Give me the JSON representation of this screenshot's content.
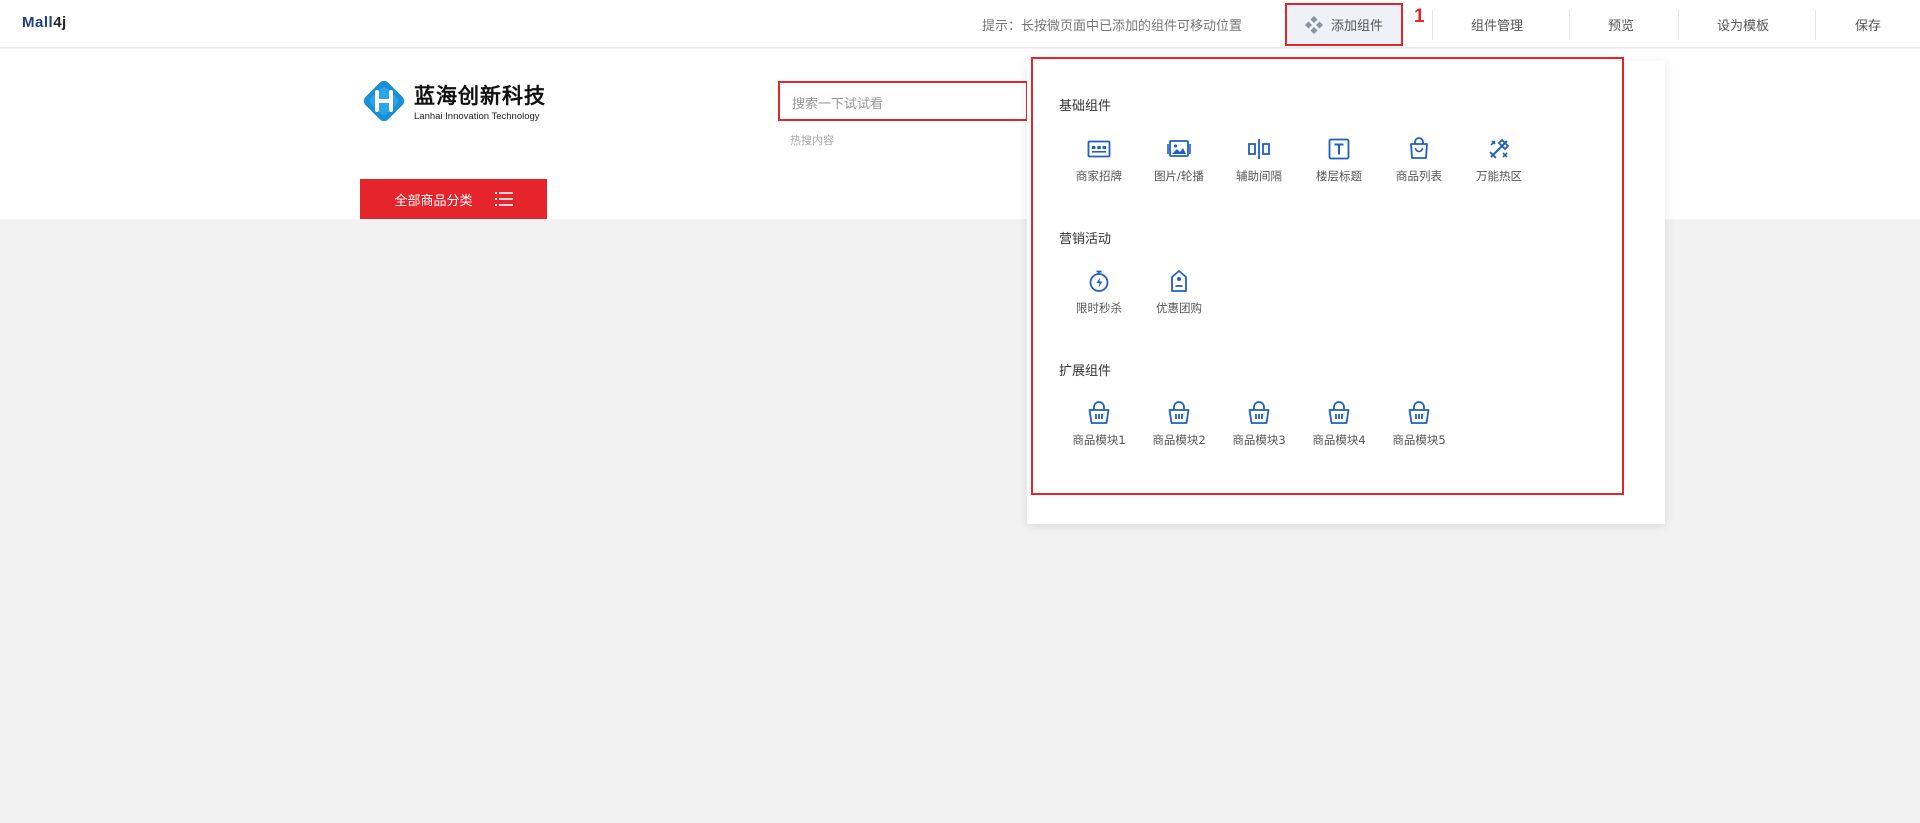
{
  "toolbar": {
    "logo": "Mall4j",
    "hint": "提示：长按微页面中已添加的组件可移动位置",
    "add_component": "添加组件",
    "annotation": "1",
    "component_manage": "组件管理",
    "preview": "预览",
    "set_template": "设为模板",
    "save": "保存"
  },
  "store": {
    "brand_name": "蓝海创新科技",
    "brand_en": "Lanhai Innovation Technology",
    "search_placeholder": "搜索一下试试看",
    "hot_search": "热搜内容",
    "all_categories": "全部商品分类"
  },
  "panel": {
    "sections": [
      {
        "title": "基础组件",
        "items": [
          {
            "label": "商家招牌",
            "icon": "store-sign-icon"
          },
          {
            "label": "图片/轮播",
            "icon": "image-carousel-icon"
          },
          {
            "label": "辅助间隔",
            "icon": "spacer-icon"
          },
          {
            "label": "楼层标题",
            "icon": "floor-title-icon"
          },
          {
            "label": "商品列表",
            "icon": "shopping-bag-icon"
          },
          {
            "label": "万能热区",
            "icon": "hotspot-icon"
          }
        ]
      },
      {
        "title": "营销活动",
        "items": [
          {
            "label": "限时秒杀",
            "icon": "timer-icon"
          },
          {
            "label": "优惠团购",
            "icon": "group-buy-tag-icon"
          }
        ]
      },
      {
        "title": "扩展组件",
        "items": [
          {
            "label": "商品模块1",
            "icon": "basket-icon"
          },
          {
            "label": "商品模块2",
            "icon": "basket-icon"
          },
          {
            "label": "商品模块3",
            "icon": "basket-icon"
          },
          {
            "label": "商品模块4",
            "icon": "basket-icon"
          },
          {
            "label": "商品模块5",
            "icon": "basket-icon"
          }
        ]
      }
    ]
  },
  "colors": {
    "accent_red": "#e5242b",
    "icon_blue": "#1f5fc9",
    "brand_navy": "#1e3f8a"
  }
}
